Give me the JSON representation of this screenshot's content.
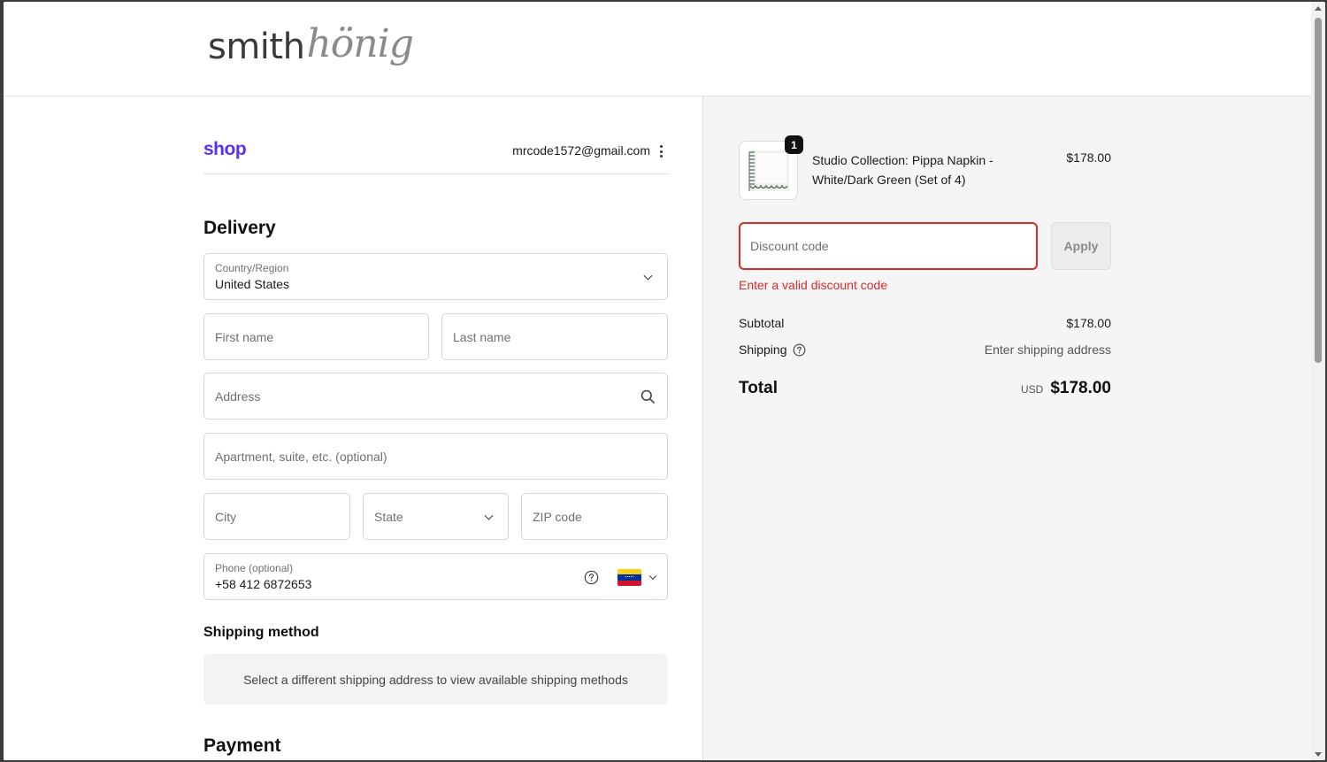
{
  "brand": {
    "logo_part1": "smith",
    "logo_part2": "hönig"
  },
  "shop_bar": {
    "shop_logo": "shop",
    "email": "mrcode1572@gmail.com"
  },
  "delivery": {
    "heading": "Delivery",
    "country": {
      "label": "Country/Region",
      "value": "United States"
    },
    "first_name": {
      "placeholder": "First name"
    },
    "last_name": {
      "placeholder": "Last name"
    },
    "address": {
      "placeholder": "Address"
    },
    "apartment": {
      "placeholder": "Apartment, suite, etc. (optional)"
    },
    "city": {
      "placeholder": "City"
    },
    "state": {
      "placeholder": "State"
    },
    "zip": {
      "placeholder": "ZIP code"
    },
    "phone": {
      "label": "Phone (optional)",
      "value": "+58 412 6872653",
      "flag_colors": [
        "#f7d117",
        "#0033a0",
        "#cf142b"
      ]
    }
  },
  "shipping_method": {
    "heading": "Shipping method",
    "note": "Select a different shipping address to view available shipping methods"
  },
  "payment": {
    "heading": "Payment"
  },
  "summary": {
    "item": {
      "quantity": "1",
      "name": "Studio Collection: Pippa Napkin - White/Dark Green (Set of 4)",
      "price": "$178.00"
    },
    "discount": {
      "placeholder": "Discount code",
      "apply_label": "Apply",
      "error": "Enter a valid discount code"
    },
    "subtotal_label": "Subtotal",
    "subtotal_value": "$178.00",
    "shipping_label": "Shipping",
    "shipping_value": "Enter shipping address",
    "total_label": "Total",
    "total_currency": "USD",
    "total_value": "$178.00"
  },
  "colors": {
    "shop_purple": "#5a31f4",
    "error_red": "#d72c2c",
    "summary_bg": "#f5f5f5"
  }
}
